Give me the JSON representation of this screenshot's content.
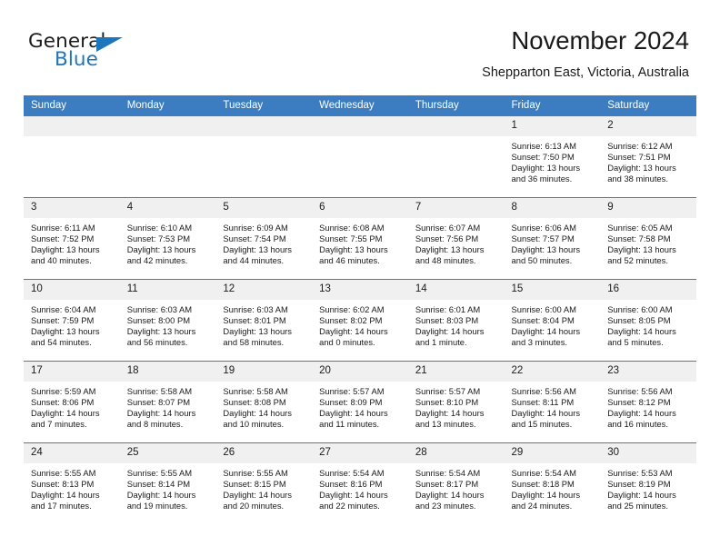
{
  "brand": {
    "name_part1": "General",
    "name_part2": "Blue",
    "mark": "triangle-logo",
    "accent_color": "#1d76bb"
  },
  "header": {
    "title": "November 2024",
    "subtitle": "Shepparton East, Victoria, Australia"
  },
  "theme": {
    "header_row_bg": "#3b7dc0",
    "daynum_bg": "#f0f0f0",
    "text_color": "#1a1a1a"
  },
  "weekday_headers": [
    "Sunday",
    "Monday",
    "Tuesday",
    "Wednesday",
    "Thursday",
    "Friday",
    "Saturday"
  ],
  "weeks": [
    [
      {
        "day": "",
        "lines": []
      },
      {
        "day": "",
        "lines": []
      },
      {
        "day": "",
        "lines": []
      },
      {
        "day": "",
        "lines": []
      },
      {
        "day": "",
        "lines": []
      },
      {
        "day": "1",
        "lines": [
          "Sunrise: 6:13 AM",
          "Sunset: 7:50 PM",
          "Daylight: 13 hours",
          "and 36 minutes."
        ]
      },
      {
        "day": "2",
        "lines": [
          "Sunrise: 6:12 AM",
          "Sunset: 7:51 PM",
          "Daylight: 13 hours",
          "and 38 minutes."
        ]
      }
    ],
    [
      {
        "day": "3",
        "lines": [
          "Sunrise: 6:11 AM",
          "Sunset: 7:52 PM",
          "Daylight: 13 hours",
          "and 40 minutes."
        ]
      },
      {
        "day": "4",
        "lines": [
          "Sunrise: 6:10 AM",
          "Sunset: 7:53 PM",
          "Daylight: 13 hours",
          "and 42 minutes."
        ]
      },
      {
        "day": "5",
        "lines": [
          "Sunrise: 6:09 AM",
          "Sunset: 7:54 PM",
          "Daylight: 13 hours",
          "and 44 minutes."
        ]
      },
      {
        "day": "6",
        "lines": [
          "Sunrise: 6:08 AM",
          "Sunset: 7:55 PM",
          "Daylight: 13 hours",
          "and 46 minutes."
        ]
      },
      {
        "day": "7",
        "lines": [
          "Sunrise: 6:07 AM",
          "Sunset: 7:56 PM",
          "Daylight: 13 hours",
          "and 48 minutes."
        ]
      },
      {
        "day": "8",
        "lines": [
          "Sunrise: 6:06 AM",
          "Sunset: 7:57 PM",
          "Daylight: 13 hours",
          "and 50 minutes."
        ]
      },
      {
        "day": "9",
        "lines": [
          "Sunrise: 6:05 AM",
          "Sunset: 7:58 PM",
          "Daylight: 13 hours",
          "and 52 minutes."
        ]
      }
    ],
    [
      {
        "day": "10",
        "lines": [
          "Sunrise: 6:04 AM",
          "Sunset: 7:59 PM",
          "Daylight: 13 hours",
          "and 54 minutes."
        ]
      },
      {
        "day": "11",
        "lines": [
          "Sunrise: 6:03 AM",
          "Sunset: 8:00 PM",
          "Daylight: 13 hours",
          "and 56 minutes."
        ]
      },
      {
        "day": "12",
        "lines": [
          "Sunrise: 6:03 AM",
          "Sunset: 8:01 PM",
          "Daylight: 13 hours",
          "and 58 minutes."
        ]
      },
      {
        "day": "13",
        "lines": [
          "Sunrise: 6:02 AM",
          "Sunset: 8:02 PM",
          "Daylight: 14 hours",
          "and 0 minutes."
        ]
      },
      {
        "day": "14",
        "lines": [
          "Sunrise: 6:01 AM",
          "Sunset: 8:03 PM",
          "Daylight: 14 hours",
          "and 1 minute."
        ]
      },
      {
        "day": "15",
        "lines": [
          "Sunrise: 6:00 AM",
          "Sunset: 8:04 PM",
          "Daylight: 14 hours",
          "and 3 minutes."
        ]
      },
      {
        "day": "16",
        "lines": [
          "Sunrise: 6:00 AM",
          "Sunset: 8:05 PM",
          "Daylight: 14 hours",
          "and 5 minutes."
        ]
      }
    ],
    [
      {
        "day": "17",
        "lines": [
          "Sunrise: 5:59 AM",
          "Sunset: 8:06 PM",
          "Daylight: 14 hours",
          "and 7 minutes."
        ]
      },
      {
        "day": "18",
        "lines": [
          "Sunrise: 5:58 AM",
          "Sunset: 8:07 PM",
          "Daylight: 14 hours",
          "and 8 minutes."
        ]
      },
      {
        "day": "19",
        "lines": [
          "Sunrise: 5:58 AM",
          "Sunset: 8:08 PM",
          "Daylight: 14 hours",
          "and 10 minutes."
        ]
      },
      {
        "day": "20",
        "lines": [
          "Sunrise: 5:57 AM",
          "Sunset: 8:09 PM",
          "Daylight: 14 hours",
          "and 11 minutes."
        ]
      },
      {
        "day": "21",
        "lines": [
          "Sunrise: 5:57 AM",
          "Sunset: 8:10 PM",
          "Daylight: 14 hours",
          "and 13 minutes."
        ]
      },
      {
        "day": "22",
        "lines": [
          "Sunrise: 5:56 AM",
          "Sunset: 8:11 PM",
          "Daylight: 14 hours",
          "and 15 minutes."
        ]
      },
      {
        "day": "23",
        "lines": [
          "Sunrise: 5:56 AM",
          "Sunset: 8:12 PM",
          "Daylight: 14 hours",
          "and 16 minutes."
        ]
      }
    ],
    [
      {
        "day": "24",
        "lines": [
          "Sunrise: 5:55 AM",
          "Sunset: 8:13 PM",
          "Daylight: 14 hours",
          "and 17 minutes."
        ]
      },
      {
        "day": "25",
        "lines": [
          "Sunrise: 5:55 AM",
          "Sunset: 8:14 PM",
          "Daylight: 14 hours",
          "and 19 minutes."
        ]
      },
      {
        "day": "26",
        "lines": [
          "Sunrise: 5:55 AM",
          "Sunset: 8:15 PM",
          "Daylight: 14 hours",
          "and 20 minutes."
        ]
      },
      {
        "day": "27",
        "lines": [
          "Sunrise: 5:54 AM",
          "Sunset: 8:16 PM",
          "Daylight: 14 hours",
          "and 22 minutes."
        ]
      },
      {
        "day": "28",
        "lines": [
          "Sunrise: 5:54 AM",
          "Sunset: 8:17 PM",
          "Daylight: 14 hours",
          "and 23 minutes."
        ]
      },
      {
        "day": "29",
        "lines": [
          "Sunrise: 5:54 AM",
          "Sunset: 8:18 PM",
          "Daylight: 14 hours",
          "and 24 minutes."
        ]
      },
      {
        "day": "30",
        "lines": [
          "Sunrise: 5:53 AM",
          "Sunset: 8:19 PM",
          "Daylight: 14 hours",
          "and 25 minutes."
        ]
      }
    ]
  ]
}
